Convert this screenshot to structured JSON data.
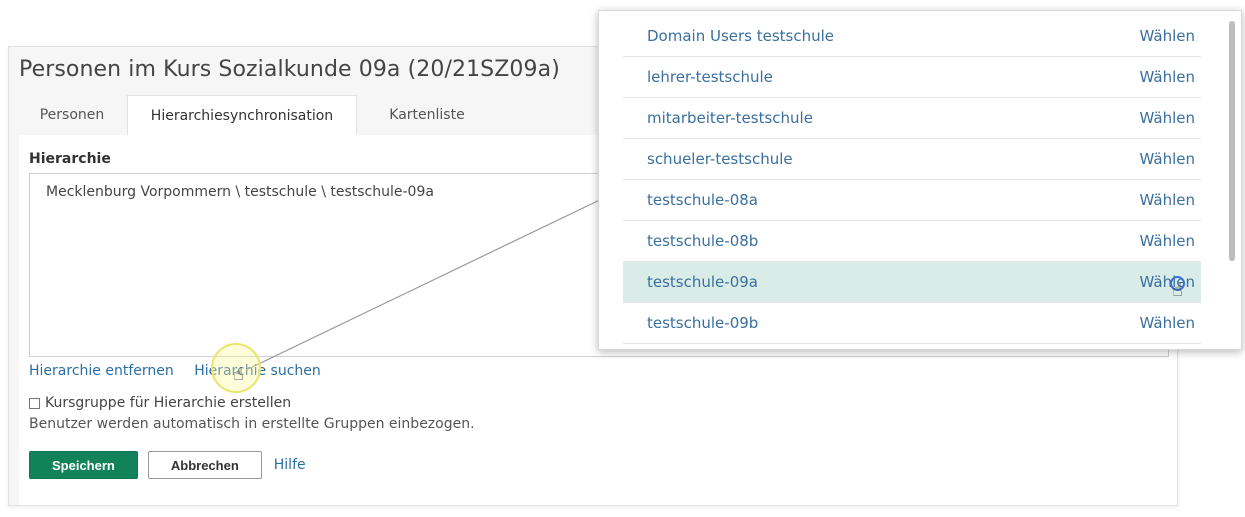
{
  "page": {
    "title": "Personen im Kurs Sozialkunde 09a (20/21SZ09a)"
  },
  "tabs": [
    {
      "label": "Personen"
    },
    {
      "label": "Hierarchiesynchronisation"
    },
    {
      "label": "Kartenliste"
    }
  ],
  "form": {
    "hierarchy_label": "Hierarchie",
    "hierarchy_value": "Mecklenburg Vorpommern \\ testschule \\ testschule-09a",
    "remove_link": "Hierarchie entfernen",
    "search_link": "Hierarchie suchen",
    "checkbox_label": "Kursgruppe für Hierarchie erstellen",
    "note": "Benutzer werden automatisch in erstellte Gruppen einbezogen."
  },
  "buttons": {
    "save": "Speichern",
    "cancel": "Abbrechen",
    "help": "Hilfe"
  },
  "dropdown": {
    "items": [
      {
        "name": "Domain Users testschule",
        "action": "Wählen"
      },
      {
        "name": "lehrer-testschule",
        "action": "Wählen"
      },
      {
        "name": "mitarbeiter-testschule",
        "action": "Wählen"
      },
      {
        "name": "schueler-testschule",
        "action": "Wählen"
      },
      {
        "name": "testschule-08a",
        "action": "Wählen"
      },
      {
        "name": "testschule-08b",
        "action": "Wählen"
      },
      {
        "name": "testschule-09a",
        "action": "Wählen"
      },
      {
        "name": "testschule-09b",
        "action": "Wählen"
      }
    ]
  },
  "colors": {
    "primary_button": "#12825a",
    "link": "#2a6ea6",
    "selected_row": "#d9ece8"
  },
  "icons": {
    "pointer": "hand-pointer-icon",
    "checkbox": "checkbox-icon"
  }
}
